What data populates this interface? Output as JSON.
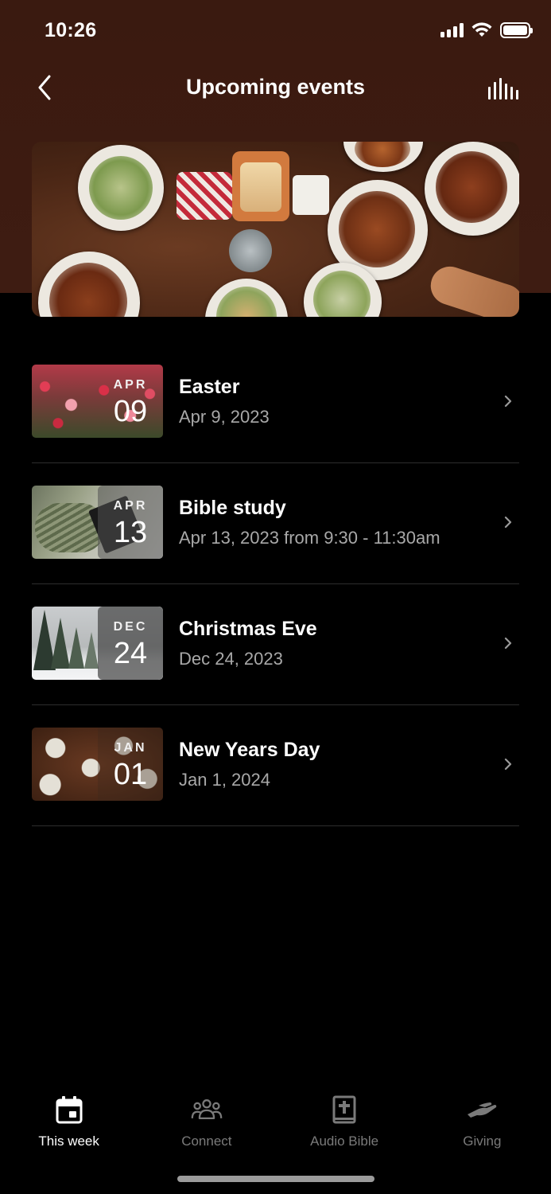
{
  "status": {
    "time": "10:26",
    "battery_level": 1.0
  },
  "nav": {
    "title": "Upcoming events"
  },
  "events": [
    {
      "title": "Easter",
      "subtitle": "Apr 9, 2023",
      "month": "APR",
      "day": "09"
    },
    {
      "title": "Bible study",
      "subtitle": "Apr 13, 2023 from 9:30 - 11:30am",
      "month": "APR",
      "day": "13"
    },
    {
      "title": "Christmas Eve",
      "subtitle": "Dec 24, 2023",
      "month": "DEC",
      "day": "24"
    },
    {
      "title": "New Years Day",
      "subtitle": "Jan 1, 2024",
      "month": "JAN",
      "day": "01"
    }
  ],
  "tabs": [
    {
      "label": "This week",
      "icon": "calendar-icon",
      "active": true
    },
    {
      "label": "Connect",
      "icon": "group-icon",
      "active": false
    },
    {
      "label": "Audio Bible",
      "icon": "bible-icon",
      "active": false
    },
    {
      "label": "Giving",
      "icon": "giving-hand-icon",
      "active": false
    }
  ],
  "colors": {
    "header_bg": "#3d1b11",
    "background": "#000000",
    "secondary_text": "#a8a8a8",
    "inactive_tab": "#7a7a7a"
  }
}
